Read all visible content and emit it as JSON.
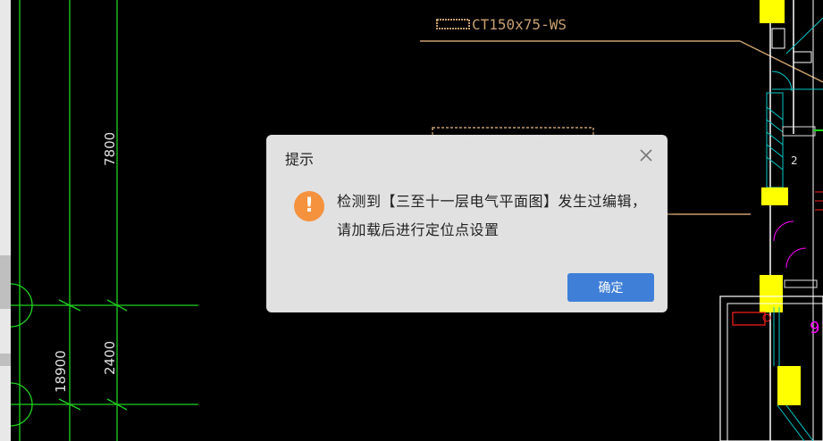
{
  "cad": {
    "labels": {
      "cable_tray": "CT150x75-WS",
      "dim_7800": "7800",
      "dim_2400": "2400",
      "dim_18900": "18900",
      "num_2": "2",
      "num_9": "9"
    }
  },
  "dialog": {
    "title": "提示",
    "message": "检测到【三至十一层电气平面图】发生过编辑，请加载后进行定位点设置",
    "confirm_label": "确定"
  },
  "colors": {
    "grid_green": "#1fd41f",
    "dim_text": "#e0e0e0",
    "annotation_tan": "#c8a070",
    "yellow_fill": "#ffff00",
    "cyan": "#00c8c8",
    "magenta": "#ff00ff",
    "red": "#ff2020",
    "dialog_bg": "#e8e8e8",
    "button_blue": "#3f7fd8",
    "warning_orange": "#f5923e"
  },
  "icons": {
    "dialog_close": "close-icon",
    "dialog_warning": "warning-icon"
  }
}
